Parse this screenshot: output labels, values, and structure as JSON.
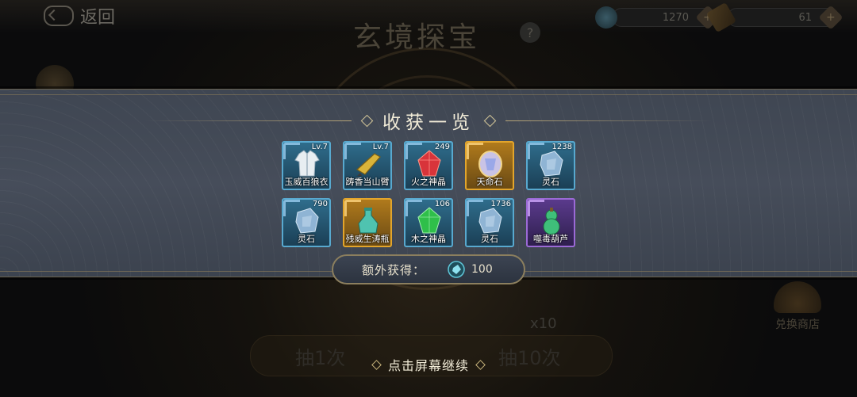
{
  "background": {
    "back_label": "返回",
    "title": "玄境探宝",
    "resources": [
      {
        "icon": "spirit-stone-icon",
        "value": "1270"
      },
      {
        "icon": "scroll-icon",
        "value": "61"
      }
    ],
    "shop_label": "兑换商店",
    "multiplier": "x10",
    "draw_one": "抽1次",
    "draw_ten": "抽10次"
  },
  "dialog": {
    "title": "收获一览",
    "items": [
      {
        "name": "玉威百狼衣",
        "badge": "Lv.7",
        "rarity": "blue",
        "icon": "armor-icon"
      },
      {
        "name": "踌香当山臂",
        "badge": "Lv.7",
        "rarity": "blue",
        "icon": "gauntlet-icon"
      },
      {
        "name": "火之神晶",
        "badge": "249",
        "rarity": "blue",
        "icon": "fire-crystal-icon"
      },
      {
        "name": "天命石",
        "badge": "",
        "rarity": "gold",
        "icon": "destiny-stone-icon"
      },
      {
        "name": "灵石",
        "badge": "1238",
        "rarity": "blue",
        "icon": "spirit-stone-icon"
      },
      {
        "name": "灵石",
        "badge": "790",
        "rarity": "blue",
        "icon": "spirit-stone-icon"
      },
      {
        "name": "残威生涛瓶",
        "badge": "",
        "rarity": "gold",
        "icon": "bottle-icon"
      },
      {
        "name": "木之神晶",
        "badge": "106",
        "rarity": "blue",
        "icon": "wood-crystal-icon"
      },
      {
        "name": "灵石",
        "badge": "1736",
        "rarity": "blue",
        "icon": "spirit-stone-icon"
      },
      {
        "name": "噬毒葫芦",
        "badge": "",
        "rarity": "purple",
        "icon": "gourd-icon"
      }
    ],
    "extra_label": "额外获得：",
    "extra_value": "100",
    "extra_icon": "spirit-gem-icon",
    "continue_label": "点击屏幕继续"
  },
  "colors": {
    "blue_frame": "#58a9cf",
    "gold_frame": "#e3a52b",
    "purple_frame": "#9b6ad6",
    "title_text": "#f2ecd8",
    "band": "#464d5a"
  }
}
